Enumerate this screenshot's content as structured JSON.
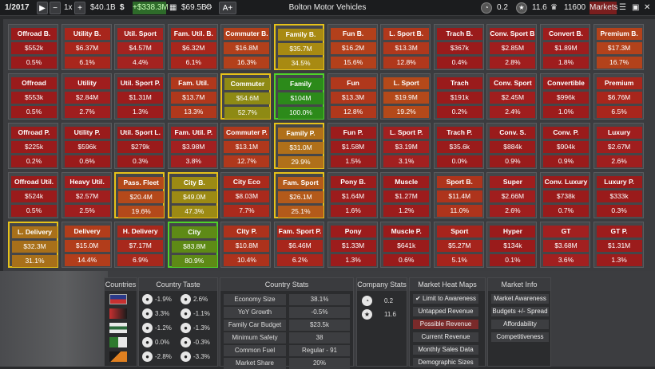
{
  "topbar": {
    "date": "1/2017",
    "play_icon": "play-icon",
    "speed": "1x",
    "funds": "$40.1B",
    "profit": "+$338.3M",
    "value": "$69.5B",
    "mode": "A+",
    "company": "Bolton Motor Vehicles",
    "stat_a": "0.2",
    "stat_b": "11.6",
    "stat_c": "11600",
    "markets_label": "Markets"
  },
  "tiles": [
    {
      "name": "Offroad B.",
      "val": "$552k",
      "pct": "0.5%",
      "color": "#9a1b1b"
    },
    {
      "name": "Utility B.",
      "val": "$6.37M",
      "pct": "6.1%",
      "color": "#a8261c"
    },
    {
      "name": "Util. Sport",
      "val": "$4.57M",
      "pct": "4.4%",
      "color": "#a42320"
    },
    {
      "name": "Fam. Util. B.",
      "val": "$6.32M",
      "pct": "6.1%",
      "color": "#a8261c"
    },
    {
      "name": "Commuter B.",
      "val": "$16.8M",
      "pct": "16.3%",
      "color": "#b3401b"
    },
    {
      "name": "Family B.",
      "val": "$35.7M",
      "pct": "34.5%",
      "color": "#a88a12"
    },
    {
      "name": "Fun B.",
      "val": "$16.2M",
      "pct": "15.6%",
      "color": "#b3401b"
    },
    {
      "name": "L. Sport B.",
      "val": "$13.3M",
      "pct": "12.8%",
      "color": "#b0381c"
    },
    {
      "name": "Trach B.",
      "val": "$367k",
      "pct": "0.4%",
      "color": "#9a1b1b"
    },
    {
      "name": "Conv. Sport B.",
      "val": "$2.85M",
      "pct": "2.8%",
      "color": "#a01e1e"
    },
    {
      "name": "Convert B.",
      "val": "$1.89M",
      "pct": "1.8%",
      "color": "#9e1d1d"
    },
    {
      "name": "Premium B.",
      "val": "$17.3M",
      "pct": "16.7%",
      "color": "#b3421b"
    },
    {
      "name": "Offroad",
      "val": "$553k",
      "pct": "0.5%",
      "color": "#9a1b1b"
    },
    {
      "name": "Utility",
      "val": "$2.84M",
      "pct": "2.7%",
      "color": "#a01e1e"
    },
    {
      "name": "Util. Sport P.",
      "val": "$1.31M",
      "pct": "1.3%",
      "color": "#9c1c1c"
    },
    {
      "name": "Fam. Util.",
      "val": "$13.7M",
      "pct": "13.3%",
      "color": "#b0381c"
    },
    {
      "name": "Commuter",
      "val": "$54.6M",
      "pct": "52.7%",
      "color": "#8e8a14"
    },
    {
      "name": "Family",
      "val": "$104M",
      "pct": "100.0%",
      "color": "#2c8a1a"
    },
    {
      "name": "Fun",
      "val": "$13.3M",
      "pct": "12.8%",
      "color": "#b0381c"
    },
    {
      "name": "L. Sport",
      "val": "$19.9M",
      "pct": "19.2%",
      "color": "#b4491a"
    },
    {
      "name": "Trach",
      "val": "$191k",
      "pct": "0.2%",
      "color": "#9a1b1b"
    },
    {
      "name": "Conv. Sport",
      "val": "$2.45M",
      "pct": "2.4%",
      "color": "#a01e1e"
    },
    {
      "name": "Convertible",
      "val": "$996k",
      "pct": "1.0%",
      "color": "#9c1c1c"
    },
    {
      "name": "Premium",
      "val": "$6.76M",
      "pct": "6.5%",
      "color": "#a8261c"
    },
    {
      "name": "Offroad P.",
      "val": "$225k",
      "pct": "0.2%",
      "color": "#9a1b1b"
    },
    {
      "name": "Utility P.",
      "val": "$596k",
      "pct": "0.6%",
      "color": "#9a1b1b"
    },
    {
      "name": "Util. Sport L.",
      "val": "$279k",
      "pct": "0.3%",
      "color": "#9a1b1b"
    },
    {
      "name": "Fam. Util. P.",
      "val": "$3.98M",
      "pct": "3.8%",
      "color": "#a22020"
    },
    {
      "name": "Commuter P.",
      "val": "$13.1M",
      "pct": "12.7%",
      "color": "#b0381c"
    },
    {
      "name": "Family P.",
      "val": "$31.0M",
      "pct": "29.9%",
      "color": "#b0701a"
    },
    {
      "name": "Fun P.",
      "val": "$1.58M",
      "pct": "1.5%",
      "color": "#9c1c1c"
    },
    {
      "name": "L. Sport P.",
      "val": "$3.19M",
      "pct": "3.1%",
      "color": "#a22020"
    },
    {
      "name": "Trach P.",
      "val": "$35.6k",
      "pct": "0.0%",
      "color": "#9a1b1b"
    },
    {
      "name": "Conv. S.",
      "val": "$884k",
      "pct": "0.9%",
      "color": "#9a1b1b"
    },
    {
      "name": "Conv. P.",
      "val": "$904k",
      "pct": "0.9%",
      "color": "#9a1b1b"
    },
    {
      "name": "Luxury",
      "val": "$2.67M",
      "pct": "2.6%",
      "color": "#a01e1e"
    },
    {
      "name": "Offroad Util.",
      "val": "$524k",
      "pct": "0.5%",
      "color": "#9a1b1b"
    },
    {
      "name": "Heavy Util.",
      "val": "$2.57M",
      "pct": "2.5%",
      "color": "#a01e1e"
    },
    {
      "name": "Pass. Fleet",
      "val": "$20.4M",
      "pct": "19.6%",
      "color": "#b4491a"
    },
    {
      "name": "City B.",
      "val": "$49.0M",
      "pct": "47.3%",
      "color": "#9c8a14"
    },
    {
      "name": "City Eco",
      "val": "$8.03M",
      "pct": "7.7%",
      "color": "#aa2a1c"
    },
    {
      "name": "Fam. Sport",
      "val": "$26.1M",
      "pct": "25.1%",
      "color": "#b35a1a"
    },
    {
      "name": "Pony B.",
      "val": "$1.64M",
      "pct": "1.6%",
      "color": "#9c1c1c"
    },
    {
      "name": "Muscle",
      "val": "$1.27M",
      "pct": "1.2%",
      "color": "#9c1c1c"
    },
    {
      "name": "Sport B.",
      "val": "$11.4M",
      "pct": "11.0%",
      "color": "#ae341c"
    },
    {
      "name": "Super",
      "val": "$2.66M",
      "pct": "2.6%",
      "color": "#a01e1e"
    },
    {
      "name": "Conv. Luxury",
      "val": "$738k",
      "pct": "0.7%",
      "color": "#9a1b1b"
    },
    {
      "name": "Luxury P.",
      "val": "$333k",
      "pct": "0.3%",
      "color": "#9a1b1b"
    },
    {
      "name": "L. Delivery",
      "val": "$32.3M",
      "pct": "31.1%",
      "color": "#a8701a"
    },
    {
      "name": "Delivery",
      "val": "$15.0M",
      "pct": "14.4%",
      "color": "#b23d1b"
    },
    {
      "name": "H. Delivery",
      "val": "$7.17M",
      "pct": "6.9%",
      "color": "#a8281c"
    },
    {
      "name": "City",
      "val": "$83.8M",
      "pct": "80.9%",
      "color": "#5e8a16"
    },
    {
      "name": "City P.",
      "val": "$10.8M",
      "pct": "10.4%",
      "color": "#ad321c"
    },
    {
      "name": "Fam. Sport P.",
      "val": "$6.46M",
      "pct": "6.2%",
      "color": "#a8261c"
    },
    {
      "name": "Pony",
      "val": "$1.33M",
      "pct": "1.3%",
      "color": "#9c1c1c"
    },
    {
      "name": "Muscle P.",
      "val": "$641k",
      "pct": "0.6%",
      "color": "#9a1b1b"
    },
    {
      "name": "Sport",
      "val": "$5.27M",
      "pct": "5.1%",
      "color": "#a6241c"
    },
    {
      "name": "Hyper",
      "val": "$134k",
      "pct": "0.1%",
      "color": "#9a1b1b"
    },
    {
      "name": "GT",
      "val": "$3.68M",
      "pct": "3.6%",
      "color": "#a22020"
    },
    {
      "name": "GT P.",
      "val": "$1.31M",
      "pct": "1.3%",
      "color": "#9c1c1c"
    }
  ],
  "panels": {
    "countries_title": "Countries",
    "taste_title": "Country Taste",
    "stats_title": "Country Stats",
    "company_title": "Company Stats",
    "heat_title": "Market Heat Maps",
    "info_title": "Market Info"
  },
  "taste": [
    {
      "a_icon": "steering-wheel-icon",
      "a": "-1.9%",
      "b_icon": "car-icon",
      "b": "2.6%"
    },
    {
      "a_icon": "seat-icon",
      "a": "3.3%",
      "b_icon": "engine-icon",
      "b": "-1.1%"
    },
    {
      "a_icon": "chassis-icon",
      "a": "-1.2%",
      "b_icon": "gearbox-icon",
      "b": "-1.3%"
    },
    {
      "a_icon": "wheel-icon",
      "a": "0.0%",
      "b_icon": "fuel-icon",
      "b": "-0.3%"
    },
    {
      "a_icon": "brakes-icon",
      "a": "-2.8%",
      "b_icon": "suspension-icon",
      "b": "-3.3%"
    }
  ],
  "stats": [
    {
      "label": "Economy Size",
      "value": "38.1%"
    },
    {
      "label": "YoY Growth",
      "value": "-0.5%"
    },
    {
      "label": "Family Car Budget",
      "value": "$23.5k"
    },
    {
      "label": "Minimum Safety",
      "value": "38"
    },
    {
      "label": "Common Fuel",
      "value": "Regular - 91"
    },
    {
      "label": "Market Share",
      "value": "20%"
    }
  ],
  "company_stats": [
    {
      "icon": "gauge-icon",
      "value": "0.2"
    },
    {
      "icon": "star-icon",
      "value": "11.6"
    }
  ],
  "heatmaps": [
    {
      "label": "Limit to Awareness",
      "checked": true
    },
    {
      "label": "Untapped Revenue"
    },
    {
      "label": "Possible Revenue",
      "selected": true
    },
    {
      "label": "Current Revenue"
    },
    {
      "label": "Monthly Sales Data"
    },
    {
      "label": "Demographic Sizes"
    }
  ],
  "market_info": [
    {
      "label": "Market Awareness"
    },
    {
      "label": "Budgets +/- Spread"
    },
    {
      "label": "Affordability"
    },
    {
      "label": "Competitiveness"
    }
  ],
  "colors": {
    "highlight_border": "#e6c21a",
    "green_border": "#4fd22a",
    "selected_heat": "#7a2a2a"
  }
}
